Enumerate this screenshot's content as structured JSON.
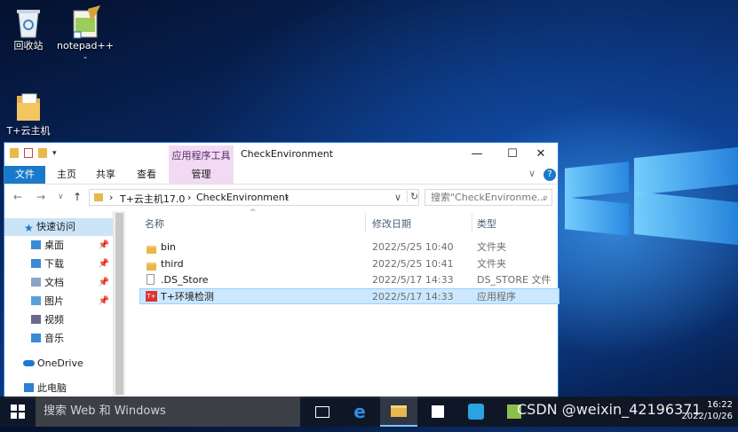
{
  "desktop": {
    "icons": [
      {
        "label": "回收站",
        "icon": "recycle-bin-icon"
      },
      {
        "label": "notepad++",
        "sublabel": "-",
        "icon": "notepad-plus-plus-icon"
      },
      {
        "label": "T+云主机",
        "icon": "folder-shortcut-icon"
      }
    ]
  },
  "window": {
    "context_tab": "应用程序工具",
    "title": "CheckEnvironment",
    "ribbon_tabs": [
      "文件",
      "主页",
      "共享",
      "查看",
      "管理"
    ],
    "controls": {
      "minimize": "—",
      "maximize": "☐",
      "close": "✕"
    },
    "address": {
      "breadcrumbs": [
        "T+云主机17.0",
        "CheckEnvironment"
      ],
      "separator": "›"
    },
    "search_placeholder": "搜索\"CheckEnvironme...",
    "sidebar": [
      {
        "label": "快速访问",
        "icon": "star-icon",
        "pinned": false,
        "selected": true
      },
      {
        "label": "桌面",
        "icon": "desktop-folder-icon",
        "pinned": true
      },
      {
        "label": "下载",
        "icon": "download-folder-icon",
        "pinned": true
      },
      {
        "label": "文档",
        "icon": "documents-folder-icon",
        "pinned": true
      },
      {
        "label": "图片",
        "icon": "pictures-folder-icon",
        "pinned": true
      },
      {
        "label": "视频",
        "icon": "videos-folder-icon",
        "pinned": false
      },
      {
        "label": "音乐",
        "icon": "music-folder-icon",
        "pinned": false
      },
      {
        "label": "OneDrive",
        "icon": "onedrive-icon",
        "pinned": false
      },
      {
        "label": "此电脑",
        "icon": "this-pc-icon",
        "pinned": false
      }
    ],
    "columns": [
      "名称",
      "修改日期",
      "类型"
    ],
    "files": [
      {
        "name": "bin",
        "date": "2022/5/25 10:40",
        "type": "文件夹",
        "icon": "folder-icon",
        "selected": false
      },
      {
        "name": "third",
        "date": "2022/5/25 10:41",
        "type": "文件夹",
        "icon": "folder-icon",
        "selected": false
      },
      {
        "name": ".DS_Store",
        "date": "2022/5/17 14:33",
        "type": "DS_STORE 文件",
        "icon": "file-icon",
        "selected": false
      },
      {
        "name": "T+环境检测",
        "date": "2022/5/17 14:33",
        "type": "应用程序",
        "icon": "app-icon",
        "selected": true
      }
    ]
  },
  "taskbar": {
    "search_placeholder": "搜索 Web 和 Windows",
    "clock_time": "16:22",
    "clock_date": "2022/10/26"
  },
  "watermark": "CSDN @weixin_42196371",
  "colors": {
    "accent": "#1979ca",
    "selection": "#cce8ff",
    "context_tab": "#f2daf5"
  }
}
